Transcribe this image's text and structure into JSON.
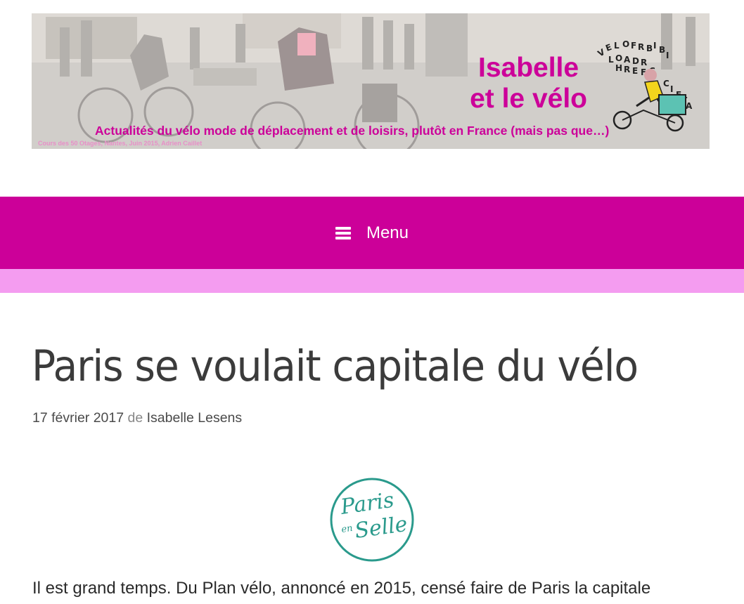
{
  "banner": {
    "title_line1": "Isabelle",
    "title_line2": "et le vélo",
    "tagline": "Actualités du vélo mode de déplacement et de loisirs, plutôt en France (mais pas que…)",
    "credit": "Cours des 50 Otages, Nantes, Juin 2015, Adrien Caillet",
    "logo_icon": "cargo-bike-rider-illustration"
  },
  "nav": {
    "menu_label": "Menu",
    "menu_icon": "hamburger-icon"
  },
  "colors": {
    "brand": "#cc0099",
    "subbar": "#f49cf0",
    "logo_teal": "#2a9a8c"
  },
  "post": {
    "title": "Paris se voulait capitale du vélo",
    "date": "17 février 2017",
    "by": "de",
    "author": "Isabelle Lesens",
    "image_logo": {
      "line1": "Paris",
      "line2": "en",
      "line3": "Selle"
    },
    "first_line": "Il est grand temps. Du Plan vélo, annoncé en 2015, censé faire de Paris la capitale"
  }
}
